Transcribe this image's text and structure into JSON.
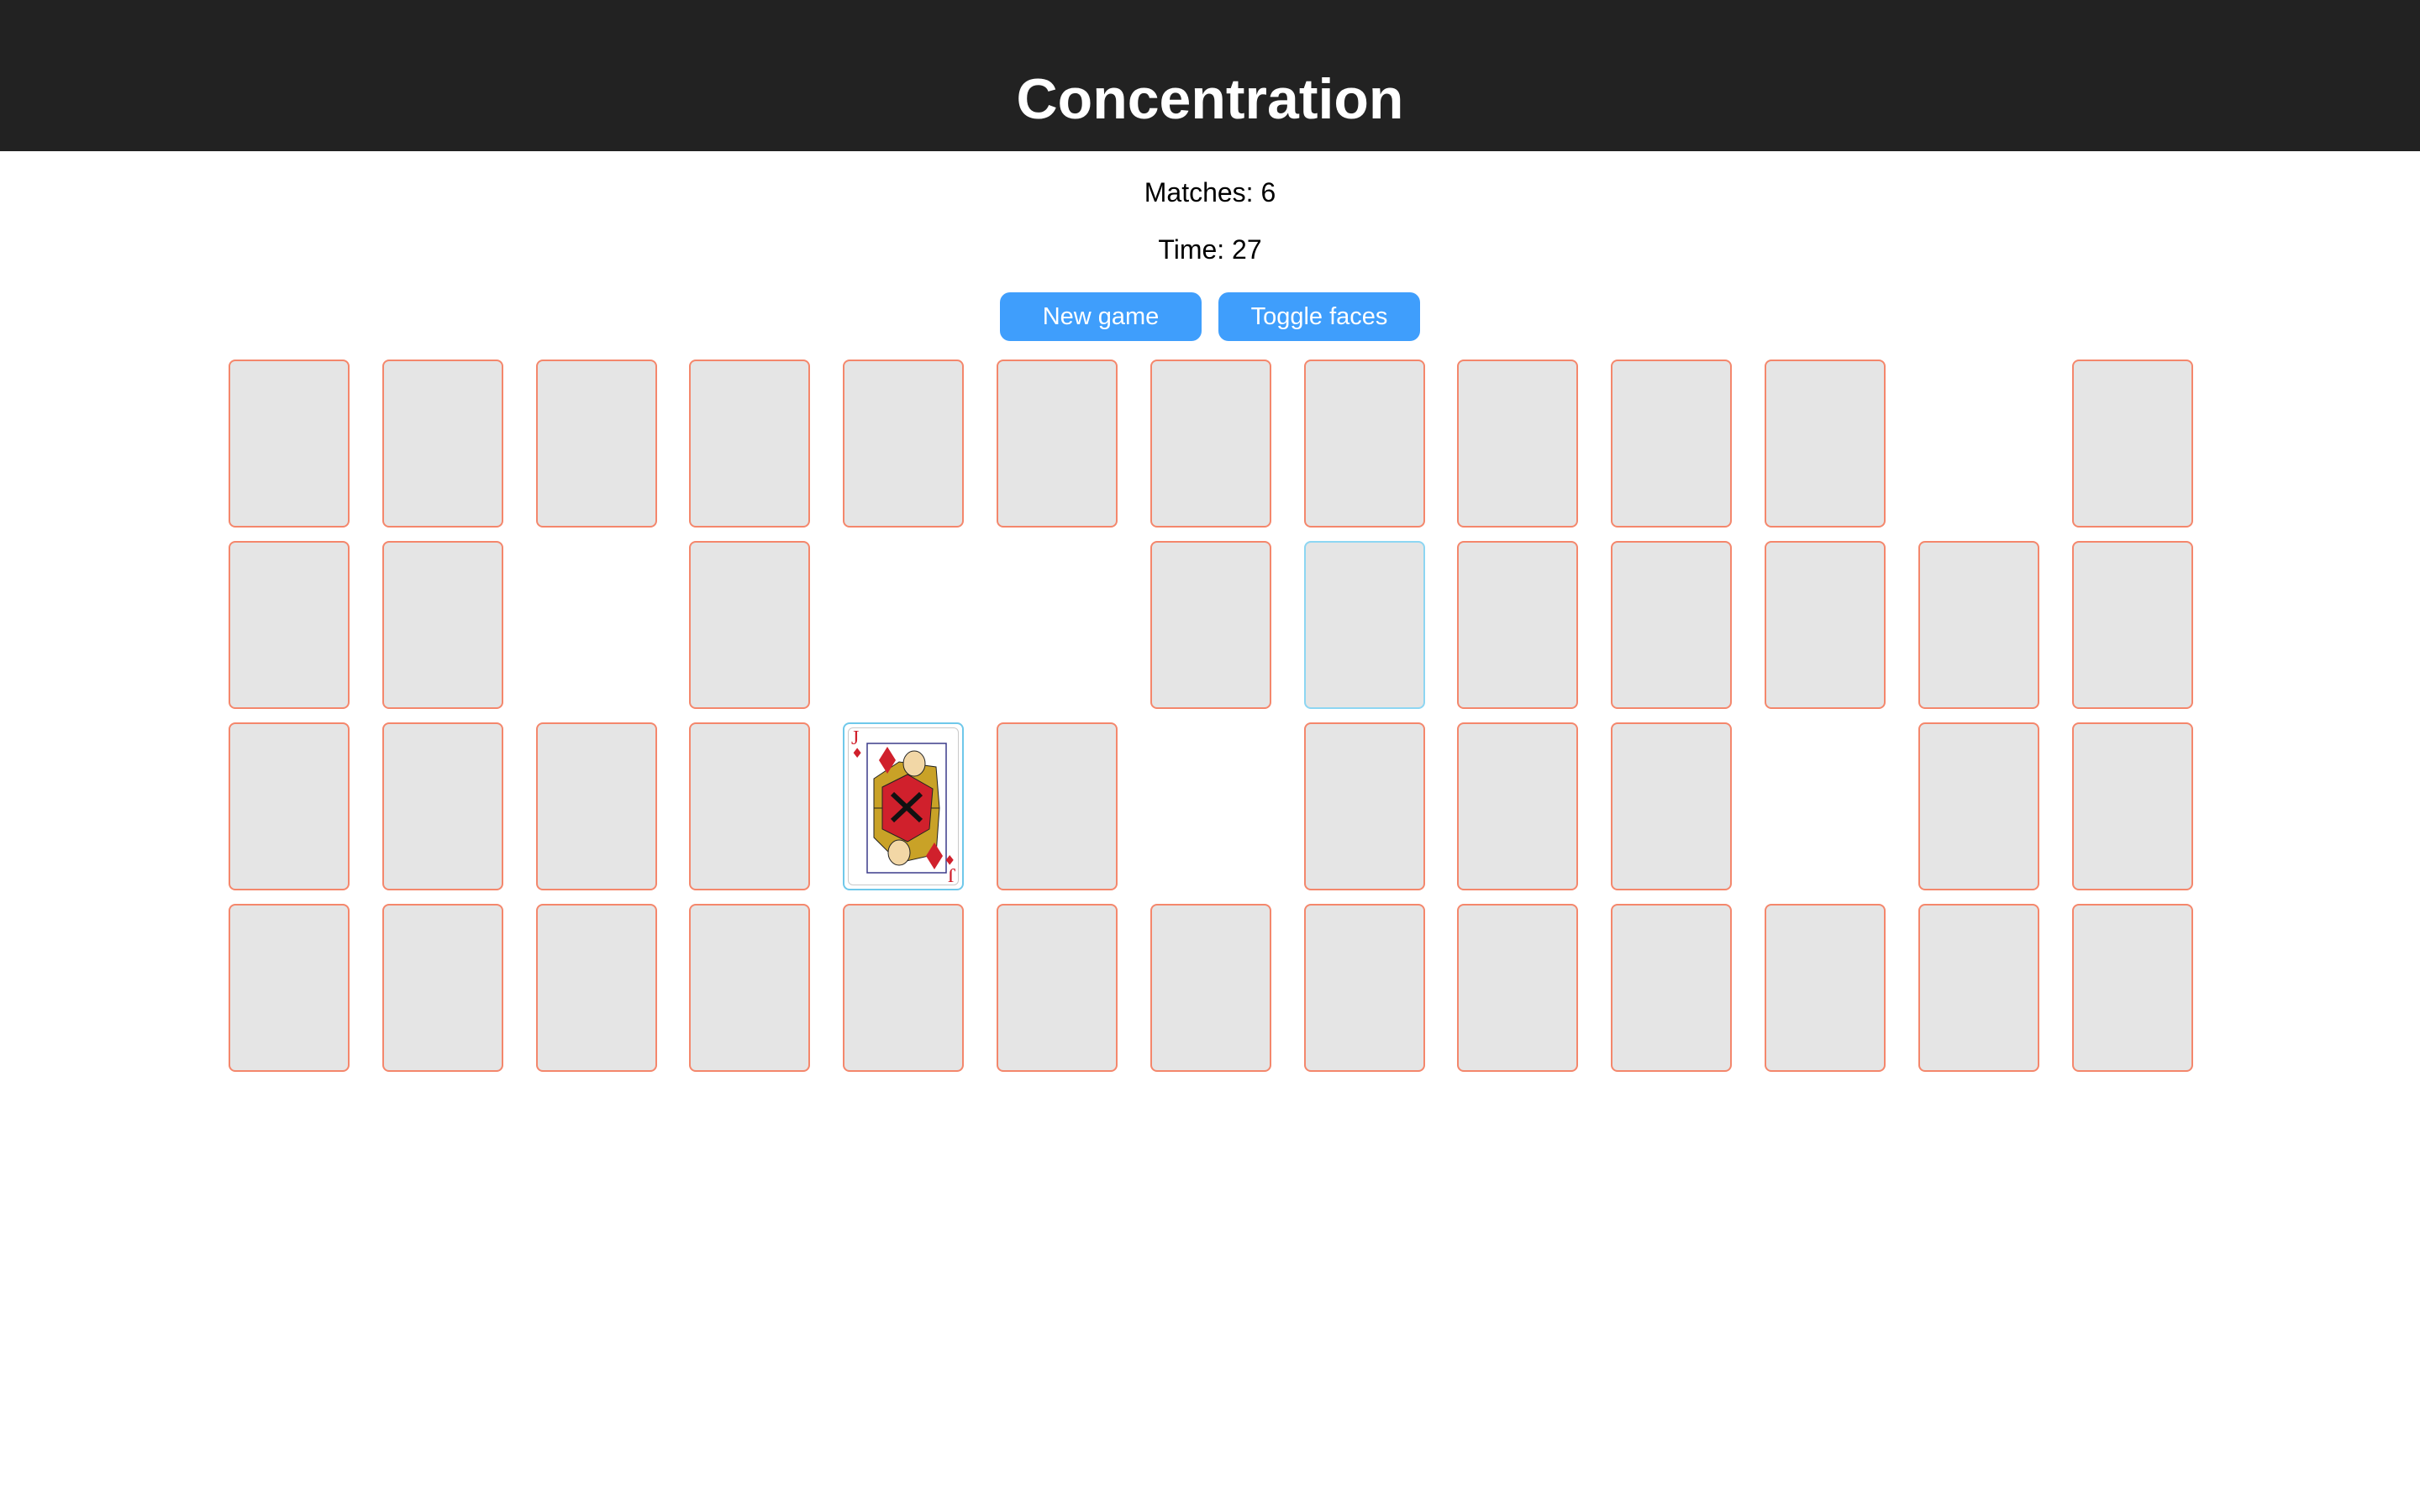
{
  "header": {
    "title": "Concentration"
  },
  "stats": {
    "matches_text": "Matches: 6",
    "time_text": "Time: 27"
  },
  "controls": {
    "new_game_label": "New game",
    "toggle_faces_label": "Toggle faces"
  },
  "colors": {
    "header_bg": "#222222",
    "button_bg": "#3f9efc",
    "card_back": "#e5e5e5",
    "card_border": "#f4876c",
    "card_selected_border": "#8dd6f2"
  },
  "board": {
    "columns": 13,
    "rows": [
      [
        "down",
        "down",
        "down",
        "down",
        "down",
        "down",
        "down",
        "down",
        "down",
        "down",
        "down",
        "empty",
        "down"
      ],
      [
        "down",
        "down",
        "empty",
        "down",
        "empty",
        "empty",
        "down",
        "selected",
        "down",
        "down",
        "down",
        "down",
        "down"
      ],
      [
        "down",
        "down",
        "down",
        "down",
        "face",
        "down",
        "empty",
        "down",
        "down",
        "down",
        "empty",
        "down",
        "down"
      ],
      [
        "down",
        "down",
        "down",
        "down",
        "down",
        "down",
        "down",
        "down",
        "down",
        "down",
        "down",
        "down",
        "down"
      ]
    ],
    "face_card": {
      "rank": "J",
      "suit": "diamonds",
      "suit_symbol": "♦",
      "suit_color": "#d0202c"
    }
  }
}
